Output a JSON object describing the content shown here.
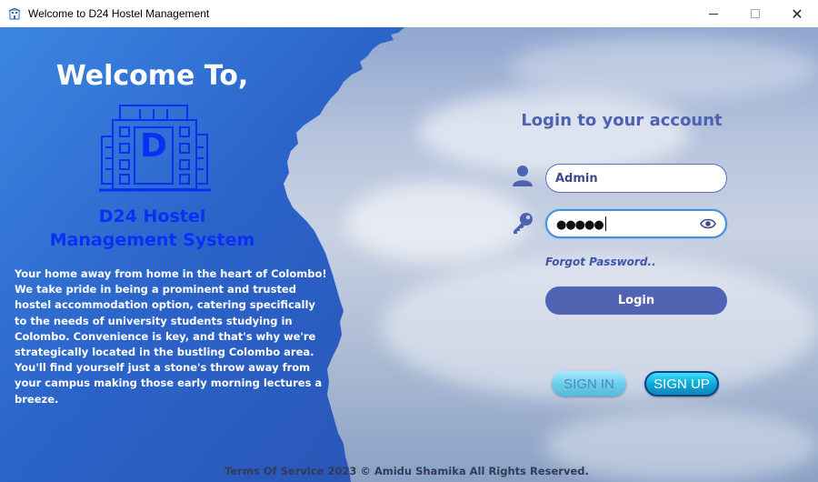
{
  "window": {
    "title": "Welcome to D24 Hostel Management",
    "icons": {
      "app": "building-icon",
      "minimize": "minimize-icon",
      "maximize": "maximize-icon",
      "close": "close-icon"
    }
  },
  "left": {
    "welcome": "Welcome To,",
    "logo_icon": "hostel-building-logo",
    "logo_letter": "D",
    "brand_line1": "D24 Hostel",
    "brand_line2": "Management System",
    "about": "Your home away from home in the heart of Colombo! We take pride in being a prominent and trusted hostel accommodation option, catering specifically to the needs of university students studying in Colombo. Convenience is key, and that's why we're strategically located in the bustling Colombo area. You'll find yourself just a stone's throw away from your campus making those early morning lectures a breeze."
  },
  "login": {
    "title": "Login to your account",
    "username_value": "Admin",
    "password_masked": "●●●●●",
    "forgot": "Forgot Password..",
    "login_button": "Login",
    "icons": {
      "user": "user-icon",
      "key": "key-icon",
      "eye": "eye-icon"
    }
  },
  "buttons": {
    "signin": "SIGN IN",
    "signup": "SIGN UP"
  },
  "footer": "Terms Of Service 2023 © Amidu Shamika All Rights Reserved.",
  "colors": {
    "brand": "#0a2ff5",
    "accent": "#5064b3",
    "left_panel": "#2f6fd6"
  }
}
